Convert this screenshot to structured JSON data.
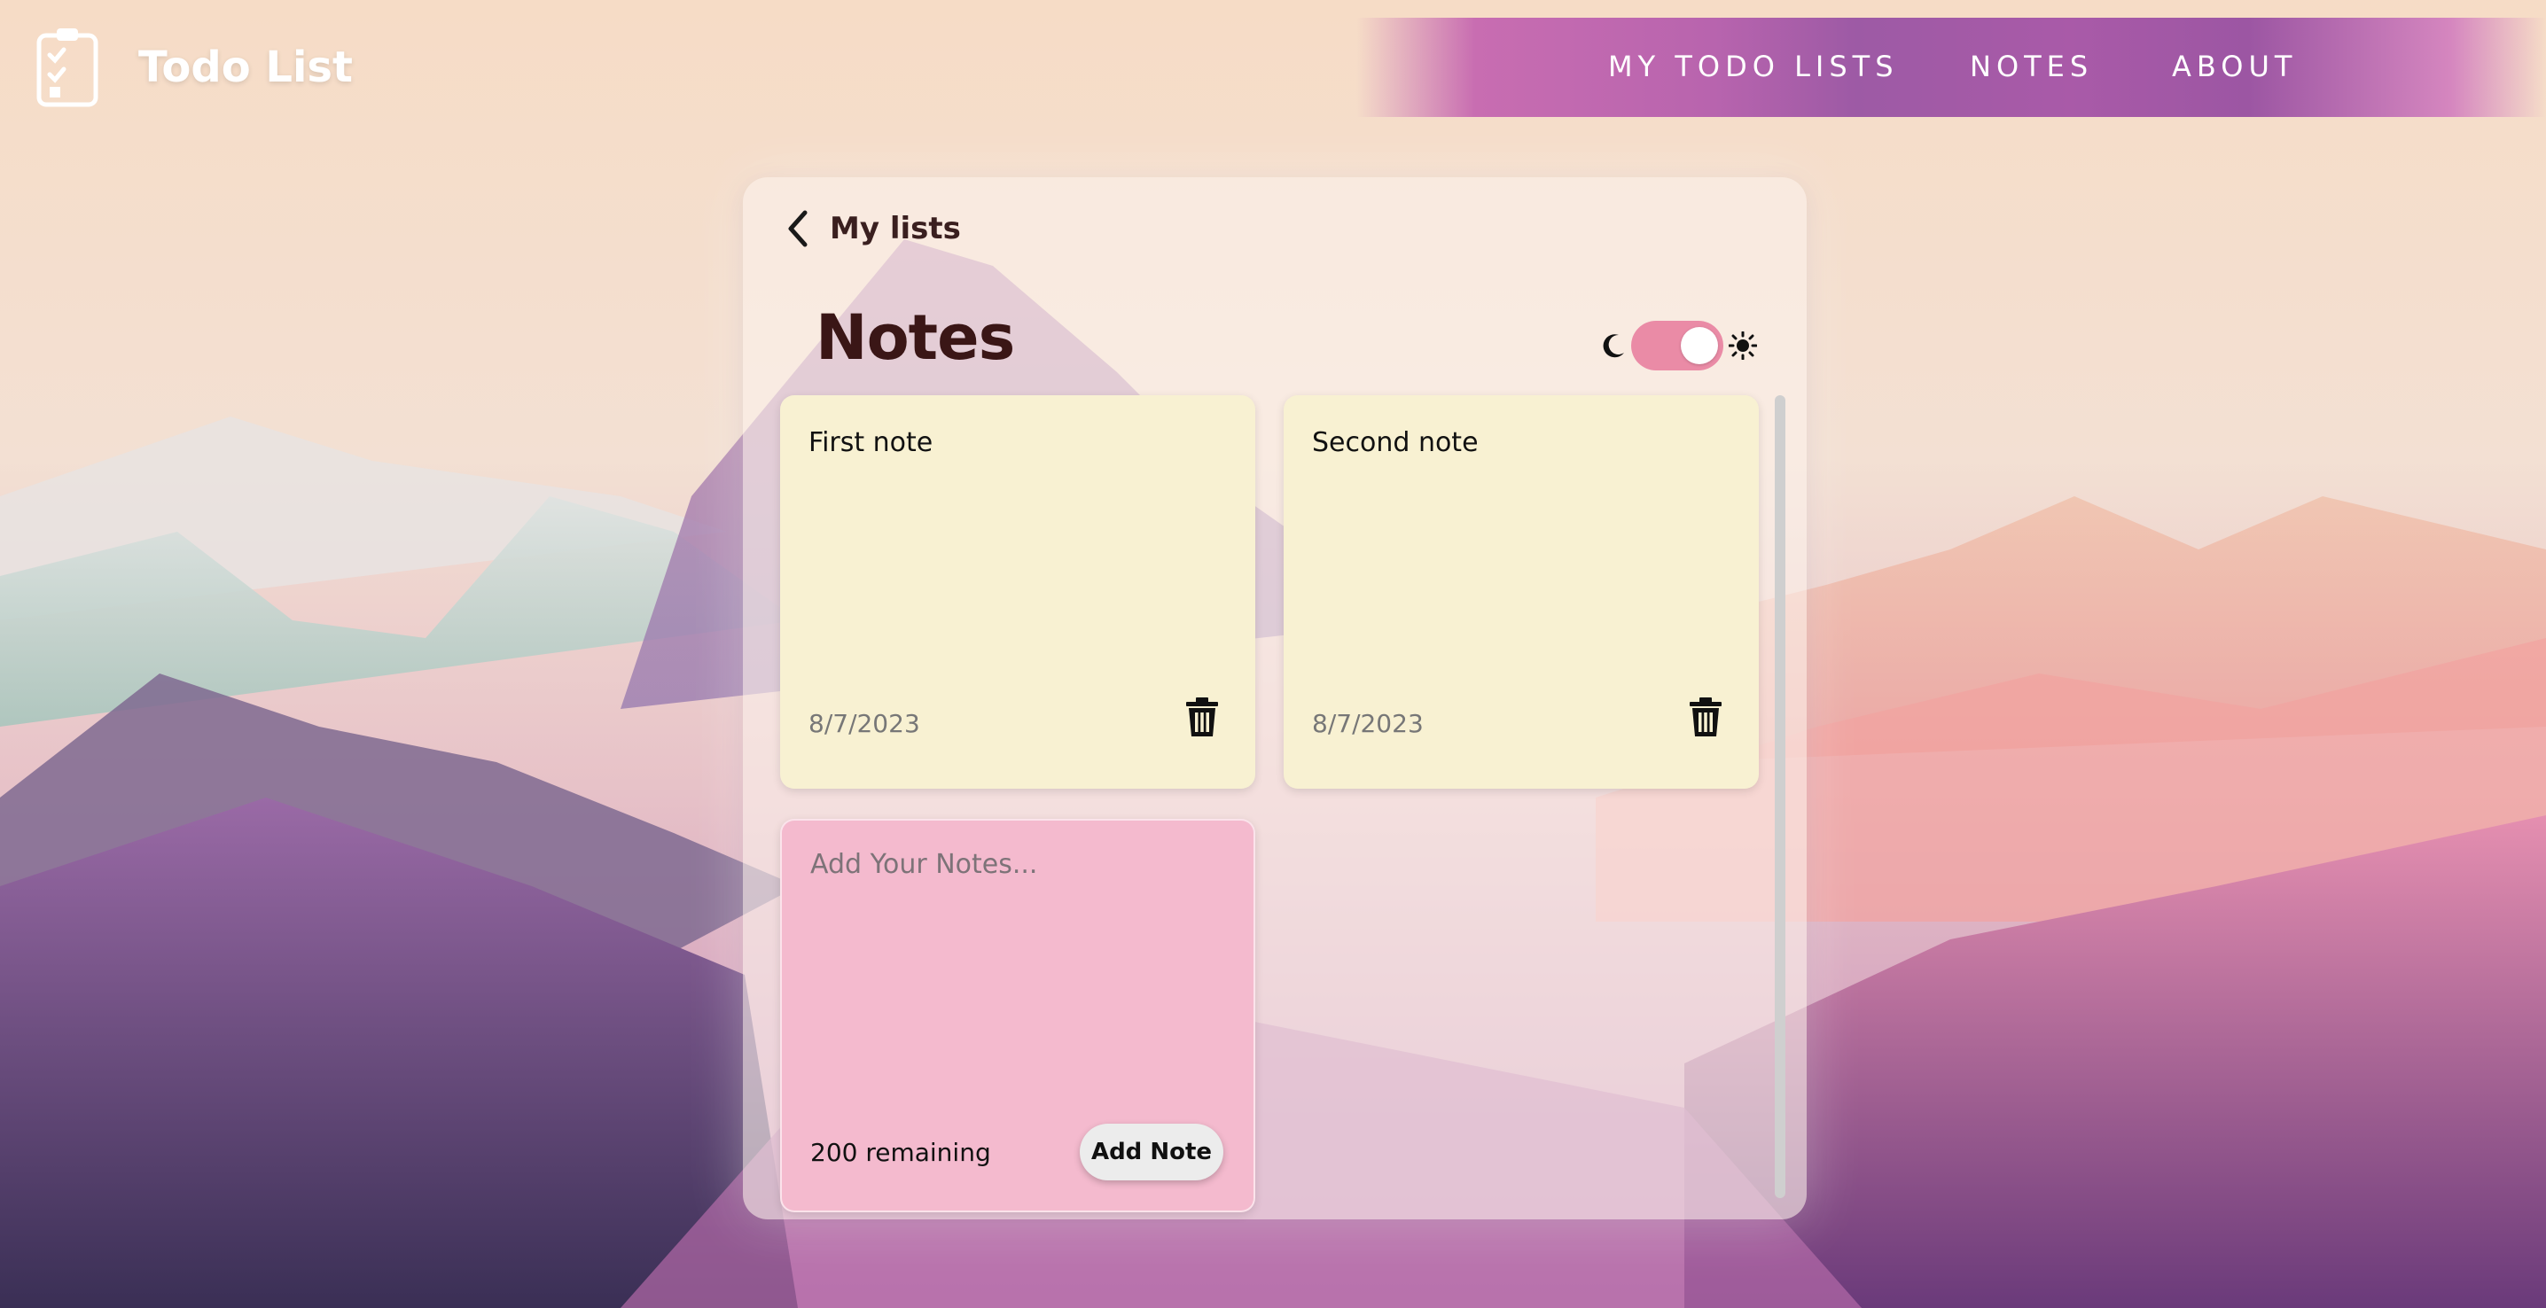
{
  "app": {
    "title": "Todo List"
  },
  "nav": {
    "items": [
      "MY TODO LISTS",
      "NOTES",
      "ABOUT"
    ]
  },
  "page": {
    "back_label": "My lists",
    "title": "Notes",
    "theme_toggle": {
      "state": "on"
    }
  },
  "notes": [
    {
      "text": "First note",
      "date": "8/7/2023"
    },
    {
      "text": "Second note",
      "date": "8/7/2023"
    }
  ],
  "new_note": {
    "placeholder": "Add Your Notes...",
    "remaining": "200 remaining",
    "button_label": "Add Note"
  },
  "colors": {
    "nav_accent": "#9d5aa5",
    "toggle": "#ea8ba6",
    "note_yellow": "#f8f1d2",
    "note_pink": "#f4bace"
  }
}
